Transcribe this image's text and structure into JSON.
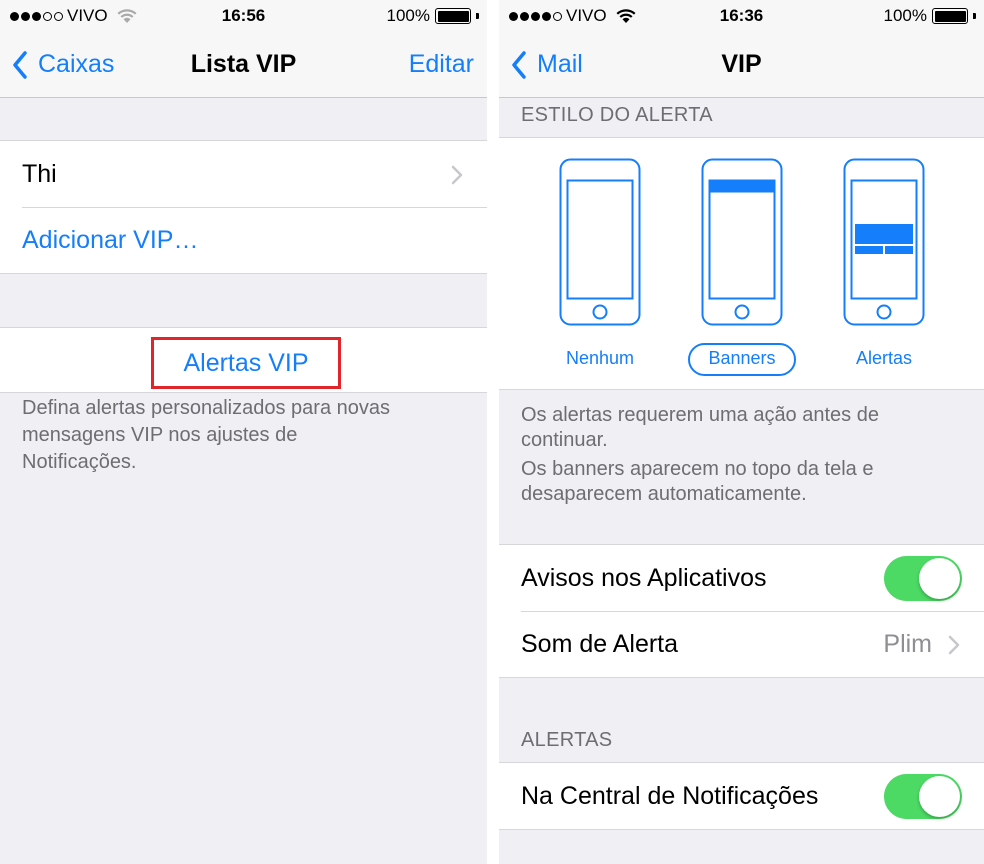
{
  "left": {
    "status": {
      "carrier": "VIVO",
      "time": "16:56",
      "battery": "100%"
    },
    "nav": {
      "back_label": "Caixas",
      "title": "Lista VIP",
      "right_label": "Editar"
    },
    "vip_list": [
      {
        "name": "Thi"
      }
    ],
    "add_vip_label": "Adicionar VIP…",
    "alerts_button_label": "Alertas VIP",
    "footnote": "Defina alertas personalizados para novas mensagens VIP nos ajustes de Notificações.",
    "footnote_lines": [
      "Defina alertas personalizados para novas",
      "mensagens VIP nos ajustes de",
      "Notificações."
    ]
  },
  "right": {
    "status": {
      "carrier": "VIVO",
      "time": "16:36",
      "battery": "100%"
    },
    "nav": {
      "back_label": "Mail",
      "title": "VIP"
    },
    "alert_style_header": "ESTILO DO ALERTA",
    "alert_styles": [
      {
        "label": "Nenhum",
        "selected": false
      },
      {
        "label": "Banners",
        "selected": true
      },
      {
        "label": "Alertas",
        "selected": false
      }
    ],
    "notes": [
      "Os alertas requerem uma ação antes de continuar.",
      "Os banners aparecem no topo da tela e desaparecem automaticamente."
    ],
    "notes_lines": [
      [
        "Os alertas requerem uma ação antes de",
        "continuar."
      ],
      [
        "Os banners aparecem no topo da tela e",
        "desaparecem automaticamente."
      ]
    ],
    "settings": [
      {
        "label": "Avisos nos Aplicativos",
        "toggle_on": true
      },
      {
        "label": "Som de Alerta",
        "value": "Plim"
      }
    ],
    "alerts_header": "ALERTAS",
    "notification_center": {
      "label": "Na Central de Notificações",
      "toggle_on": true
    }
  },
  "colors": {
    "accent": "#157efb",
    "toggle_on": "#4cd964",
    "highlight_border": "#e0262b",
    "background": "#efeff4"
  }
}
